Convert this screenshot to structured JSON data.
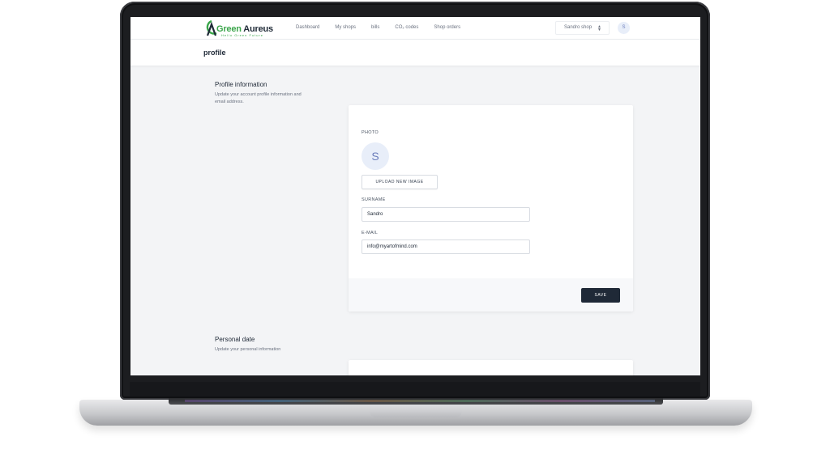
{
  "brand": {
    "name_part1": "Green",
    "name_part2": " Aureus",
    "tagline": "Hello Green Future",
    "green": "#3aa54a",
    "dark": "#1f2a37"
  },
  "nav": {
    "links": [
      "Dashboard",
      "My shops",
      "bills",
      "CO₂ codes",
      "Shop orders"
    ],
    "shop_select": "Sandro shop",
    "user_initial": "S"
  },
  "page": {
    "title": "profile"
  },
  "profile_section": {
    "title": "Profile information",
    "description": "Update your account profile information and email address.",
    "photo_label": "PHOTO",
    "photo_initial": "S",
    "upload_label": "UPLOAD NEW IMAGE",
    "surname_label": "SURNAME",
    "surname_value": "Sandro",
    "email_label": "E-MAIL",
    "email_value": "info@myartofmind.com",
    "save_label": "SAVE"
  },
  "personal_section": {
    "title": "Personal date",
    "description": "Update your personal information"
  }
}
